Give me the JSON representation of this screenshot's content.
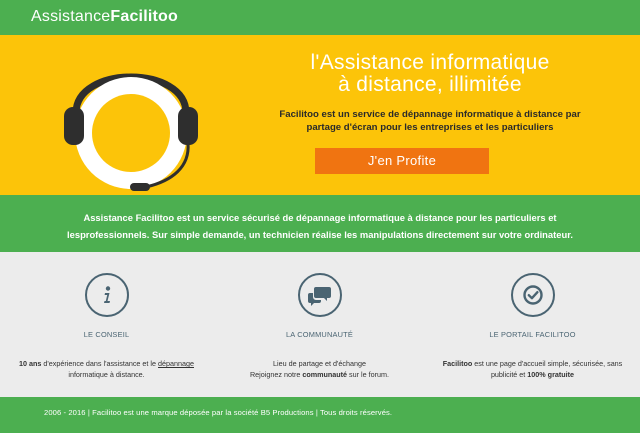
{
  "header": {
    "brand_light": "Assistance",
    "brand_bold": "Facilitoo"
  },
  "hero": {
    "title_line1": "l'Assistance informatique",
    "title_line2": "à distance, illimitée",
    "text_line1": "Facilitoo est un service de dépannage informatique à distance par",
    "text_line2": "partage d'écran pour les entreprises et les particuliers",
    "cta_label": "J'en Profite"
  },
  "intro": {
    "line1": "Assistance Facilitoo est un service sécurisé de dépannage informatique à distance pour les particuliers et",
    "line2": "lesprofessionnels. Sur simple demande, un technicien réalise les manipulations directement sur votre ordinateur."
  },
  "features": [
    {
      "icon": "info-icon",
      "title": "LE CONSEIL",
      "desc_line1_bold": "10 ans",
      "desc_line1_text": " d'expérience dans l'assistance et le ",
      "desc_line1_link": "dépannage",
      "desc_line2": "informatique à distance."
    },
    {
      "icon": "chat-bubbles-icon",
      "title": "LA COMMUNAUTÉ",
      "desc_line1": "Lieu de partage et d'échange",
      "desc_line2_pre": "Rejoignez notre ",
      "desc_line2_bold": "communauté",
      "desc_line2_post": " sur le forum."
    },
    {
      "icon": "check-circle-icon",
      "title": "LE PORTAIL FACILITOO",
      "desc_line1_bold": "Facilitoo",
      "desc_line1_text": " est une page d'accueil simple, sécurisée, sans",
      "desc_line2_pre": "publicité et ",
      "desc_line2_bold": "100% gratuite"
    }
  ],
  "footer": {
    "text": "2006 - 2016 | Facilitoo est une marque déposée par la société B5 Productions | Tous droits réservés."
  },
  "colors": {
    "green": "#4caf50",
    "yellow": "#fcc409",
    "orange": "#f07411",
    "icon_slate": "#4a6472"
  }
}
